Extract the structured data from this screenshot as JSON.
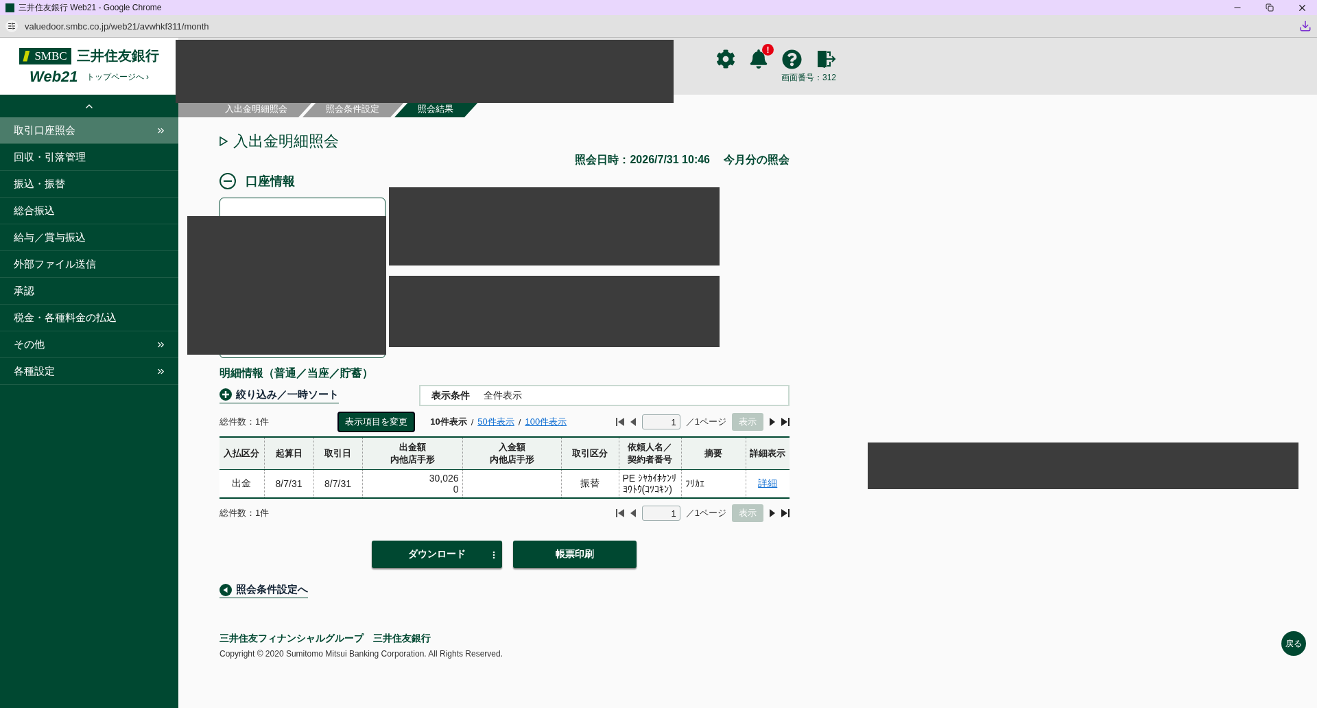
{
  "browser": {
    "tab_title": "三井住友銀行 Web21 - Google Chrome",
    "url": "valuedoor.smbc.co.jp/web21/avwhkf311/month"
  },
  "header": {
    "logo_mark": "SMBC",
    "logo_bank": "三井住友銀行",
    "logo_product": "Web21",
    "top_link": "トップページへ ›",
    "notification_badge": "!",
    "screen_number": "画面番号：312"
  },
  "sidebar": {
    "items": [
      {
        "label": "取引口座照会",
        "selected": true,
        "has_submenu": true
      },
      {
        "label": "回収・引落管理",
        "selected": false,
        "has_submenu": false
      },
      {
        "label": "振込・振替",
        "selected": false,
        "has_submenu": false
      },
      {
        "label": "総合振込",
        "selected": false,
        "has_submenu": false
      },
      {
        "label": "給与／賞与振込",
        "selected": false,
        "has_submenu": false
      },
      {
        "label": "外部ファイル送信",
        "selected": false,
        "has_submenu": false
      },
      {
        "label": "承認",
        "selected": false,
        "has_submenu": false
      },
      {
        "label": "税金・各種料金の払込",
        "selected": false,
        "has_submenu": false
      },
      {
        "label": "その他",
        "selected": false,
        "has_submenu": true
      },
      {
        "label": "各種設定",
        "selected": false,
        "has_submenu": true
      }
    ]
  },
  "breadcrumb": [
    {
      "label": "入出金明細照会",
      "selected": false
    },
    {
      "label": "照会条件設定",
      "selected": false
    },
    {
      "label": "照会結果",
      "selected": true
    }
  ],
  "page_title": "入出金明細照会",
  "query_time": "照会日時：2026/7/31 10:46",
  "query_scope": "今月分の照会",
  "account_section": {
    "title": "口座情報",
    "expanded": true
  },
  "details": {
    "title": "明細情報（普通／当座／貯蓄）",
    "filter_link": "絞り込み／一時ソート",
    "condition_label": "表示条件",
    "condition_value": "全件表示",
    "total_top": "総件数：1件",
    "change_columns": "表示項目を変更",
    "page_sizes": [
      {
        "label": "10件表示",
        "selected": true,
        "separator": "/"
      },
      {
        "label": "50件表示",
        "selected": false,
        "separator": "/"
      },
      {
        "label": "100件表示",
        "selected": false
      }
    ],
    "pager_top": {
      "page": "1",
      "of": "／1ページ",
      "go": "表示",
      "go_disabled": true
    },
    "table": {
      "columns": [
        {
          "lines": [
            "入払区分"
          ],
          "kind": "center"
        },
        {
          "lines": [
            "起算日"
          ],
          "kind": "center"
        },
        {
          "lines": [
            "取引日"
          ],
          "kind": "center"
        },
        {
          "lines": [
            "出金額",
            "内他店手形"
          ],
          "kind": "amount"
        },
        {
          "lines": [
            "入金額",
            "内他店手形"
          ],
          "kind": "amount"
        },
        {
          "lines": [
            "取引区分"
          ],
          "kind": "center"
        },
        {
          "lines": [
            "依頼人名／",
            "契約者番号"
          ],
          "kind": "left"
        },
        {
          "lines": [
            "摘要"
          ],
          "kind": "left"
        },
        {
          "lines": [
            "詳細表示"
          ],
          "kind": "link"
        }
      ],
      "rows": [
        {
          "cells": [
            [
              "出金"
            ],
            [
              "8/7/31"
            ],
            [
              "8/7/31"
            ],
            [
              "30,026",
              "0"
            ],
            null,
            [
              "振替"
            ],
            [
              "PE ｼﾔｶｲﾎｹﾝﾘ",
              "ﾖｳﾄｳ(ｺﾂｺｷﾝ)"
            ],
            [
              "ﾌﾘｶｴ"
            ],
            [
              "詳細"
            ]
          ]
        }
      ]
    },
    "total_bottom": "総件数：1件",
    "pager_bottom": {
      "page": "1",
      "of": "／1ページ",
      "go": "表示",
      "go_disabled": true
    }
  },
  "buttons": {
    "download": "ダウンロード",
    "print": "帳票印刷"
  },
  "back_link": "照会条件設定へ",
  "footer": {
    "group": "三井住友フィナンシャルグループ　三井住友銀行",
    "copyright": "Copyright © 2020 Sumitomo Mitsui Banking Corporation. All Rights Reserved."
  },
  "back_button": "戻る"
}
